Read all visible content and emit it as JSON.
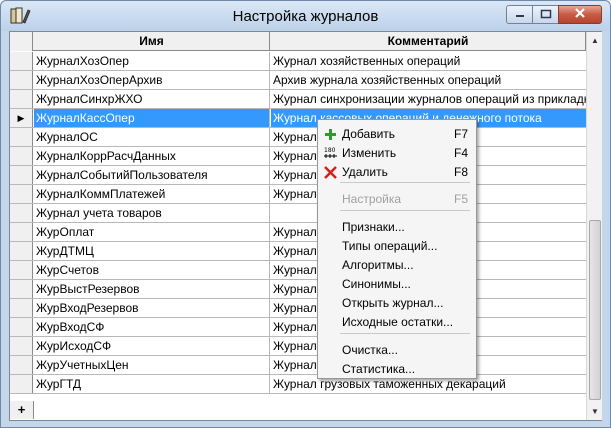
{
  "window": {
    "title": "Настройка журналов"
  },
  "icons": {
    "app": "journal-app-icon",
    "minimize": "minimize-icon",
    "maximize": "maximize-icon",
    "close": "close-icon"
  },
  "grid": {
    "columns": [
      "Имя",
      "Комментарий"
    ],
    "rows": [
      {
        "name": "ЖурналХозОпер",
        "comment": "Журнал хозяйственных операций"
      },
      {
        "name": "ЖурналХозОперАрхив",
        "comment": "Архив журнала хозяйственных операций"
      },
      {
        "name": "ЖурналСинхрЖХО",
        "comment": "Журнал синхронизации журналов операций из прикладных"
      },
      {
        "name": "ЖурналКассОпер",
        "comment": "Журнал кассовых операций и денежного потока"
      },
      {
        "name": "ЖурналОС",
        "comment": "Журнал"
      },
      {
        "name": "ЖурналКоррРасчДанных",
        "comment": "Журнал расчетных данных"
      },
      {
        "name": "ЖурналСобытийПользователя",
        "comment": "Журнал"
      },
      {
        "name": "ЖурналКоммПлатежей",
        "comment": "Журнал"
      },
      {
        "name": "Журнал учета товаров",
        "comment": ""
      },
      {
        "name": "ЖурОплат",
        "comment": "Журнал"
      },
      {
        "name": "ЖурДТМЦ",
        "comment": "Журнал"
      },
      {
        "name": "ЖурСчетов",
        "comment": "Журнал счетов"
      },
      {
        "name": "ЖурВыстРезервов",
        "comment": "Журнал"
      },
      {
        "name": "ЖурВходРезервов",
        "comment": "Журнал"
      },
      {
        "name": "ЖурВходСФ",
        "comment": "Журнал"
      },
      {
        "name": "ЖурИсходСФ",
        "comment": "Журнал"
      },
      {
        "name": "ЖурУчетныхЦен",
        "comment": "Журнал"
      },
      {
        "name": "ЖурГТД",
        "comment": "Журнал грузовых таможенных декараций"
      }
    ],
    "selected_row_index": 3,
    "current_row_marker": "▶",
    "new_row_marker": "+"
  },
  "context_menu": {
    "items": [
      {
        "label": "Добавить",
        "shortcut": "F7",
        "icon": "add-icon",
        "enabled": true
      },
      {
        "label": "Изменить",
        "shortcut": "F4",
        "icon": "edit-icon",
        "enabled": true
      },
      {
        "label": "Удалить",
        "shortcut": "F8",
        "icon": "delete-icon",
        "enabled": true
      },
      {
        "label": "Настройка",
        "shortcut": "F5",
        "icon": "",
        "enabled": false
      },
      {
        "label": "Признаки...",
        "shortcut": "",
        "icon": "",
        "enabled": true
      },
      {
        "label": "Типы операций...",
        "shortcut": "",
        "icon": "",
        "enabled": true
      },
      {
        "label": "Алгоритмы...",
        "shortcut": "",
        "icon": "",
        "enabled": true
      },
      {
        "label": "Синонимы...",
        "shortcut": "",
        "icon": "",
        "enabled": true
      },
      {
        "label": "Открыть журнал...",
        "shortcut": "",
        "icon": "",
        "enabled": true
      },
      {
        "label": "Исходные остатки...",
        "shortcut": "",
        "icon": "",
        "enabled": true
      },
      {
        "label": "Очистка...",
        "shortcut": "",
        "icon": "",
        "enabled": true
      },
      {
        "label": "Статистика...",
        "shortcut": "",
        "icon": "",
        "enabled": true
      }
    ]
  },
  "colors": {
    "selection": "#3399ff",
    "title_bar": "#c9dbef",
    "close_button": "#c75b45"
  }
}
